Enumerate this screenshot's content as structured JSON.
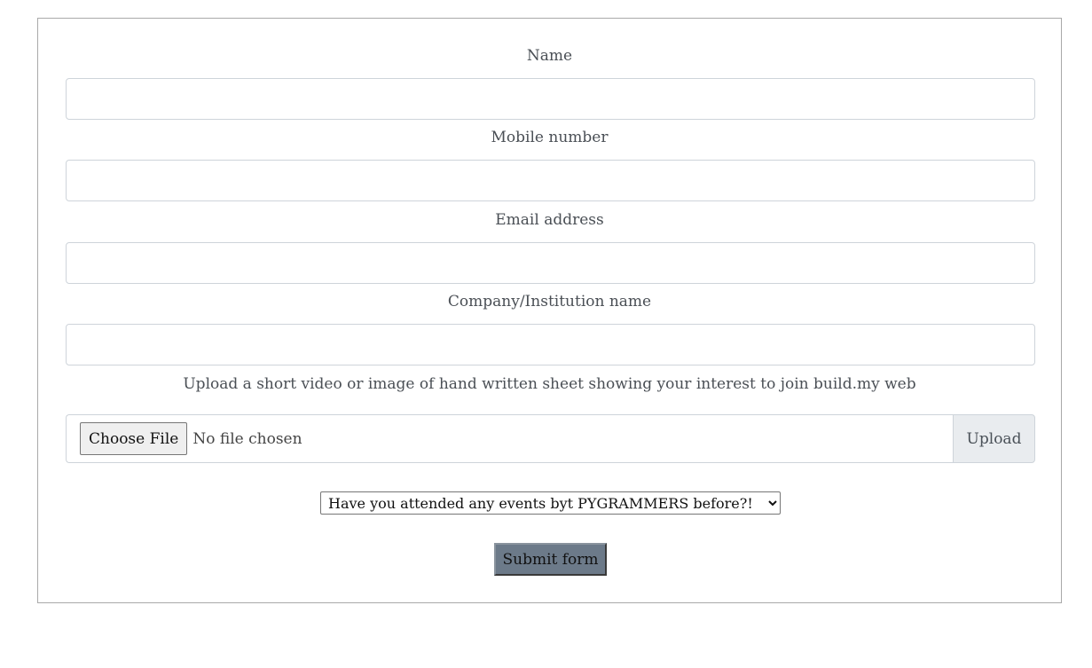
{
  "form": {
    "fields": {
      "name": {
        "label": "Name",
        "value": "",
        "placeholder": ""
      },
      "mobile": {
        "label": "Mobile number",
        "value": "",
        "placeholder": ""
      },
      "email": {
        "label": "Email address",
        "value": "",
        "placeholder": ""
      },
      "company": {
        "label": "Company/Institution name",
        "value": "",
        "placeholder": ""
      }
    },
    "upload": {
      "label": "Upload a short video or image of hand written sheet showing your interest to join build.my web",
      "choose_label": "Choose File",
      "status": "No file chosen",
      "button_label": "Upload"
    },
    "events_select": {
      "selected": "Have you attended any events byt PYGRAMMERS before?!"
    },
    "submit_label": "Submit form"
  }
}
